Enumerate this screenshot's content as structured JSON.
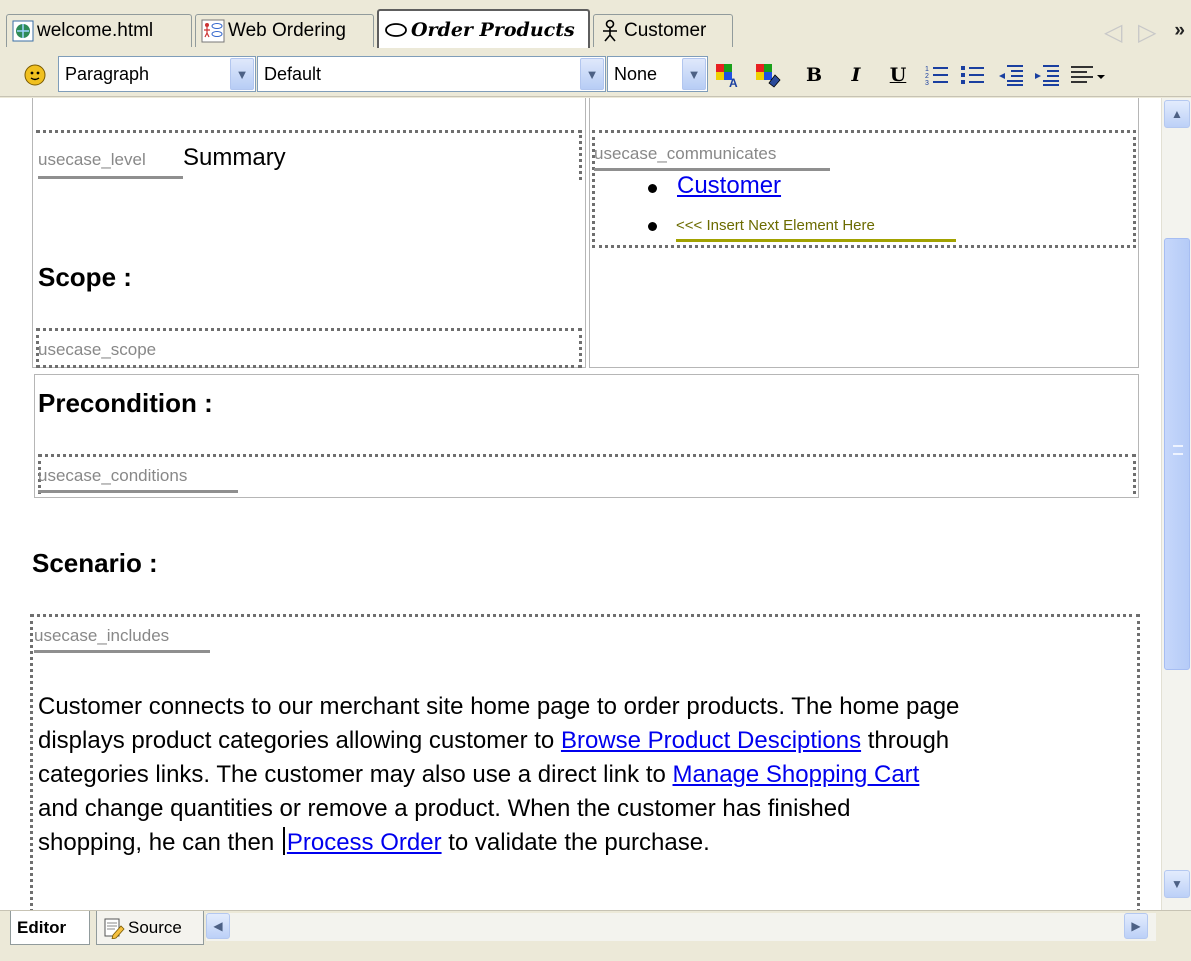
{
  "tabs": [
    {
      "label": "welcome.html",
      "icon": "globe-icon",
      "active": false
    },
    {
      "label": "Web Ordering",
      "icon": "diagram-icon",
      "active": false
    },
    {
      "label": "Order Products",
      "icon": "usecase-ellipse-icon",
      "active": true
    },
    {
      "label": "Customer",
      "icon": "actor-icon",
      "active": false
    }
  ],
  "toolbar": {
    "style_value": "Paragraph",
    "font_value": "Default",
    "size_value": "None",
    "bold_label": "B",
    "italic_label": "I",
    "underline_label": "U"
  },
  "document": {
    "usecase_level_tag": "usecase_level",
    "level_value": "Summary",
    "communicates_tag": "usecase_communicates",
    "communicates_items": [
      "Customer"
    ],
    "insert_hint": "<<< Insert Next Element Here",
    "scope_heading": "Scope :",
    "scope_tag": "usecase_scope",
    "precondition_heading": "Precondition :",
    "conditions_tag": "usecase_conditions",
    "scenario_heading": "Scenario :",
    "includes_tag": "usecase_includes",
    "scenario": {
      "line1": "Customer connects to our merchant site home page to order products. The home page",
      "line2_pre": "displays product categories allowing customer to ",
      "line2_link": "Browse Product Desciptions",
      "line2_post": " through",
      "line3_pre": "categories links. The customer may also use a direct link to ",
      "line3_link": "Manage Shopping Cart",
      "line4": "and change quantities or remove a product. When the customer has finished",
      "line5_pre": "shopping, he can then ",
      "line5_link": "Process Order",
      "line5_post": " to validate the purchase."
    }
  },
  "bottom_tabs": [
    {
      "label": "Editor",
      "active": true
    },
    {
      "label": "Source",
      "active": false
    }
  ]
}
